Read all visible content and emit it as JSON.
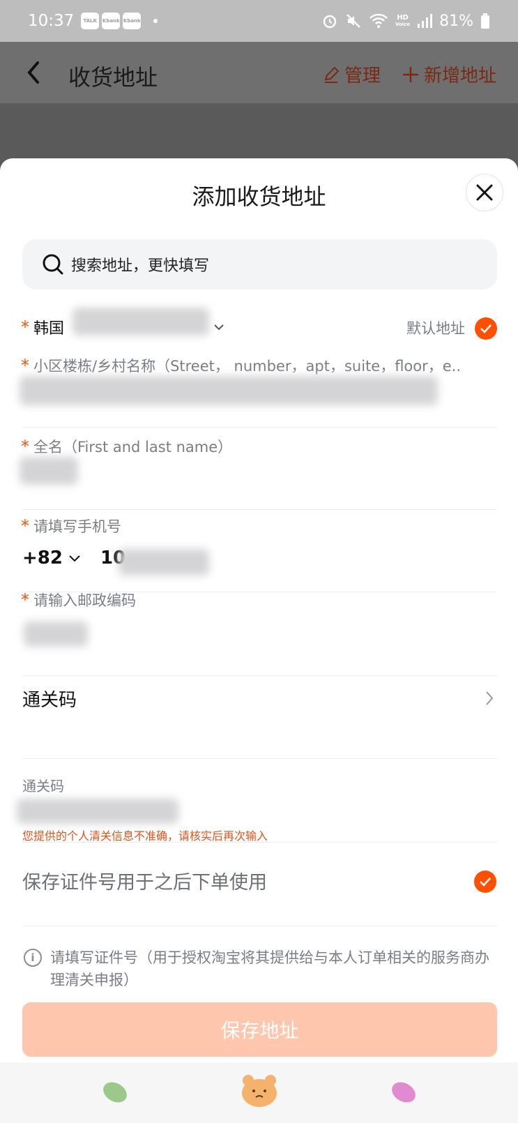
{
  "status_bar": {
    "time": "10:37",
    "notif_badges": [
      "TALK",
      "Kbank",
      "Kbank"
    ],
    "network": "HD",
    "network_sub": "Voice",
    "battery": "81%"
  },
  "header": {
    "title": "收货地址",
    "manage_label": "管理",
    "new_address_label": "新增地址"
  },
  "sheet": {
    "title": "添加收货地址",
    "search_placeholder": "搜索地址，更快填写",
    "country": "韩国",
    "default_address_label": "默认地址",
    "default_checked": true,
    "street_label": "小区楼栋/乡村名称（Street， number，apt，suite，floor，e..",
    "fullname_label": "全名（First and last name）",
    "phone_label": "请填写手机号",
    "phone_code": "+82",
    "phone_prefix": "10",
    "postal_label": "请输入邮政编码",
    "customs_row_label": "通关码",
    "customs_field_label": "通关码",
    "customs_error": "您提供的个人清关信息不准确，请核实后再次输入",
    "save_id_label": "保存证件号用于之后下单使用",
    "save_id_checked": true,
    "info_text": "请填写证件号（用于授权淘宝将其提供给与本人订单相关的服务商办理清关申报）",
    "save_button": "保存地址"
  },
  "colors": {
    "accent": "#ff5000",
    "save_button_disabled": "#ffc6ae",
    "error": "#e0541b"
  }
}
